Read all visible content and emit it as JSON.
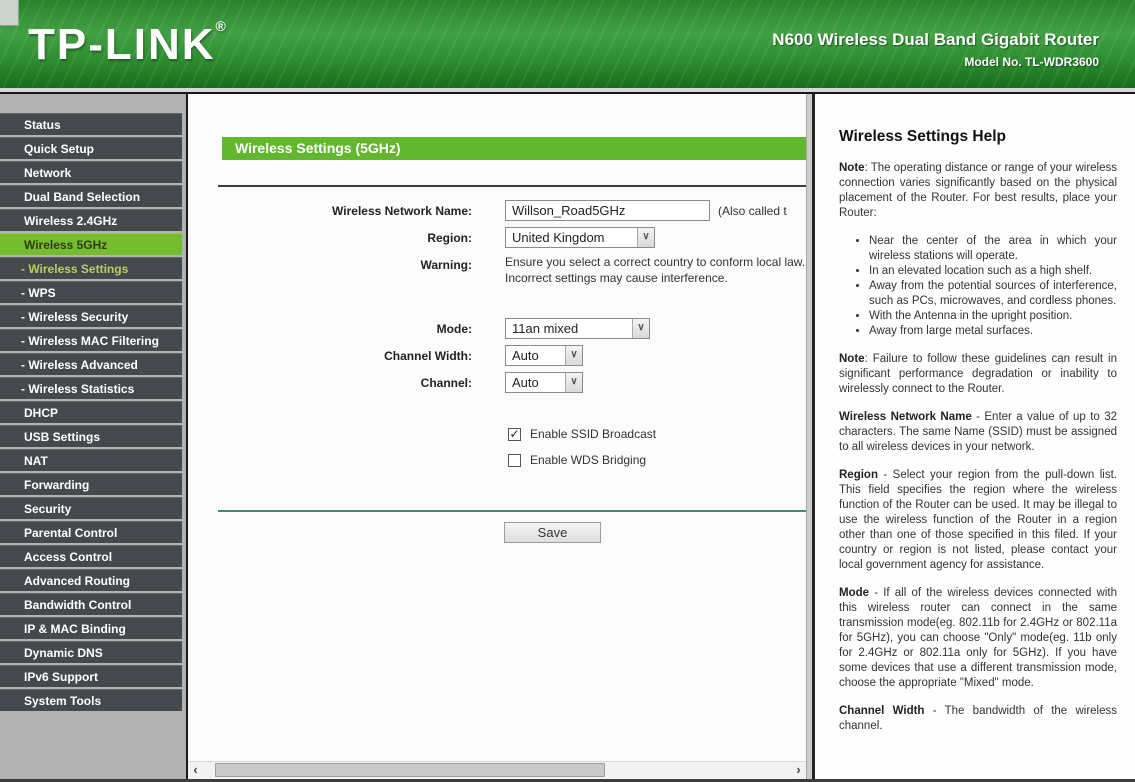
{
  "header": {
    "logo": "TP-LINK",
    "registered_mark": "®",
    "product_name": "N600 Wireless Dual Band Gigabit Router",
    "model": "Model No. TL-WDR3600"
  },
  "sidebar": {
    "items": [
      {
        "label": "Status"
      },
      {
        "label": "Quick Setup"
      },
      {
        "label": "Network"
      },
      {
        "label": "Dual Band Selection"
      },
      {
        "label": "Wireless 2.4GHz"
      },
      {
        "label": "Wireless 5GHz",
        "selected": true
      },
      {
        "label": "- Wireless Settings",
        "active": true
      },
      {
        "label": "- WPS"
      },
      {
        "label": "- Wireless Security"
      },
      {
        "label": "- Wireless MAC Filtering"
      },
      {
        "label": "- Wireless Advanced"
      },
      {
        "label": "- Wireless Statistics"
      },
      {
        "label": "DHCP"
      },
      {
        "label": "USB Settings"
      },
      {
        "label": "NAT"
      },
      {
        "label": "Forwarding"
      },
      {
        "label": "Security"
      },
      {
        "label": "Parental Control"
      },
      {
        "label": "Access Control"
      },
      {
        "label": "Advanced Routing"
      },
      {
        "label": "Bandwidth Control"
      },
      {
        "label": "IP & MAC Binding"
      },
      {
        "label": "Dynamic DNS"
      },
      {
        "label": "IPv6 Support"
      },
      {
        "label": "System Tools"
      }
    ]
  },
  "main": {
    "title": "Wireless Settings (5GHz)",
    "form": {
      "network_name_label": "Wireless Network Name:",
      "network_name_value": "Willson_Road5GHz",
      "network_name_hint": "(Also called t",
      "region_label": "Region:",
      "region_value": "United Kingdom",
      "warning_label": "Warning:",
      "warning_line1": "Ensure you select a correct country to conform local law.",
      "warning_line2": "Incorrect settings may cause interference.",
      "mode_label": "Mode:",
      "mode_value": "11an mixed",
      "channel_width_label": "Channel Width:",
      "channel_width_value": "Auto",
      "channel_label": "Channel:",
      "channel_value": "Auto",
      "ssid_broadcast_label": "Enable SSID Broadcast",
      "ssid_broadcast_checked": true,
      "wds_bridging_label": "Enable WDS Bridging",
      "wds_bridging_checked": false,
      "save_label": "Save"
    }
  },
  "help": {
    "title": "Wireless Settings Help",
    "p1_term": "Note",
    "p1_text": ": The operating distance or range of your wireless connection varies significantly based on the physical placement of the Router. For best results, place your Router:",
    "bullets": [
      "Near the center of the area in which your wireless stations will operate.",
      "In an elevated location such as a high shelf.",
      "Away from the potential sources of interference, such as PCs, microwaves, and cordless phones.",
      "With the Antenna in the upright position.",
      "Away from large metal surfaces."
    ],
    "p2_term": "Note",
    "p2_text": ": Failure to follow these guidelines can result in significant performance degradation or inability to wirelessly connect to the Router.",
    "p3_term": "Wireless Network Name",
    "p3_text": " - Enter a value of up to 32 characters. The same Name (SSID) must be assigned to all wireless devices in your network.",
    "p4_term": "Region",
    "p4_text": " - Select your region from the pull-down list. This field specifies the region where the wireless function of the Router can be used. It may be illegal to use the wireless function of the Router in a region other than one of those specified in this filed. If your country or region is not listed, please contact your local government agency for assistance.",
    "p5_term": "Mode",
    "p5_text": " - If all of the wireless devices connected with this wireless router can connect in the same transmission mode(eg. 802.11b for 2.4GHz or 802.11a for 5GHz), you can choose \"Only\" mode(eg. 11b only for 2.4GHz or 802.11a only for 5GHz). If you have some devices that use a different transmission mode, choose the appropriate \"Mixed\" mode.",
    "p6_term": "Channel Width",
    "p6_text": " - The bandwidth of the wireless channel."
  },
  "icons": {
    "dropdown_arrow": "∨",
    "check": "✓",
    "scroll_left": "‹",
    "scroll_right": "›"
  },
  "colors": {
    "header_green": "#2e8d30",
    "accent_green": "#62b72f",
    "selected_menu_green": "#75bd2f",
    "active_sub_text": "#b9cf63",
    "sidebar_item_bg": "#45494e"
  }
}
